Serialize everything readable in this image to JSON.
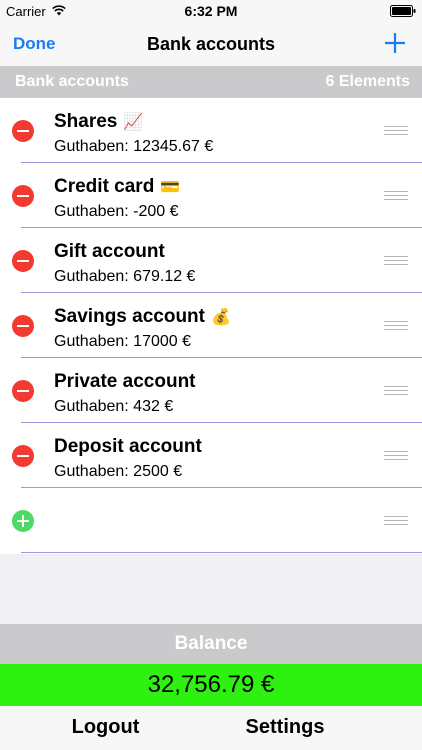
{
  "status_bar": {
    "carrier": "Carrier",
    "time": "6:32 PM"
  },
  "nav": {
    "done_label": "Done",
    "title": "Bank accounts",
    "add_icon": "plus-icon"
  },
  "section": {
    "title": "Bank accounts",
    "count": "6 Elements"
  },
  "accounts": [
    {
      "name": "Shares",
      "emoji": "📈",
      "balance": "Guthaben: 12345.67 €"
    },
    {
      "name": "Credit card",
      "emoji": "💳",
      "balance": "Guthaben: -200 €"
    },
    {
      "name": "Gift account",
      "emoji": "",
      "balance": "Guthaben: 679.12 €"
    },
    {
      "name": "Savings account",
      "emoji": "💰",
      "balance": "Guthaben: 17000 €"
    },
    {
      "name": "Private account",
      "emoji": "",
      "balance": "Guthaben: 432 €"
    },
    {
      "name": "Deposit account",
      "emoji": "",
      "balance": "Guthaben: 2500 €"
    }
  ],
  "balance": {
    "label": "Balance",
    "value": "32,756.79 €"
  },
  "bottom_bar": {
    "logout_label": "Logout",
    "settings_label": "Settings"
  },
  "colors": {
    "accent": "#1a7cf0",
    "delete": "#f23a30",
    "insert": "#4cd964",
    "balance_bg": "#2ef011"
  }
}
